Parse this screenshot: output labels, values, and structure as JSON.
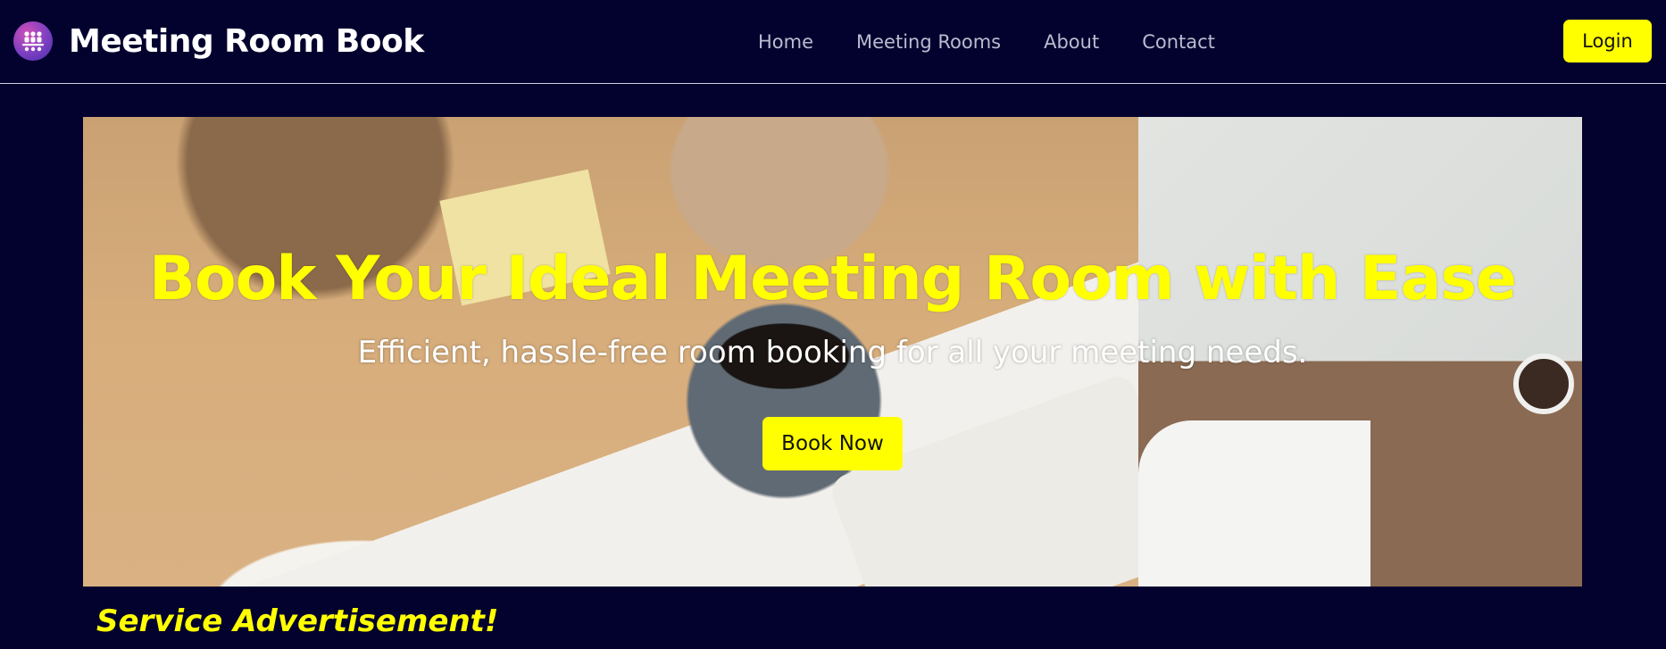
{
  "navbar": {
    "brand_title": "Meeting Room Book",
    "brand_icon": "meeting-people-icon",
    "links": [
      {
        "label": "Home"
      },
      {
        "label": "Meeting Rooms"
      },
      {
        "label": "About"
      },
      {
        "label": "Contact"
      }
    ],
    "login_label": "Login"
  },
  "hero": {
    "title": "Book Your Ideal Meeting Room with Ease",
    "subtitle": "Efficient, hassle-free room booking for all your meeting needs.",
    "cta_label": "Book Now"
  },
  "service": {
    "heading": "Service Advertisement!"
  },
  "colors": {
    "background": "#03022e",
    "accent": "#ffff00",
    "nav_text": "#b9bcd0",
    "brand_text": "#ffffff"
  }
}
